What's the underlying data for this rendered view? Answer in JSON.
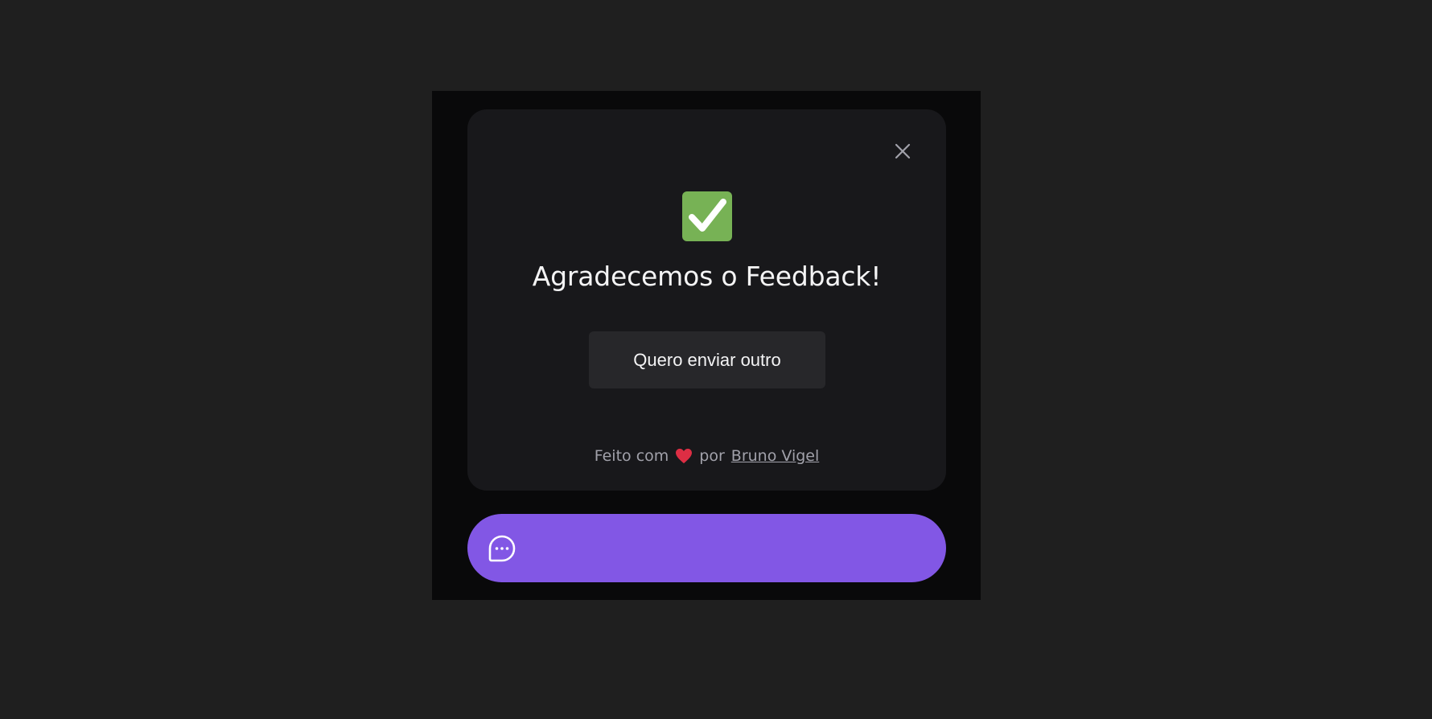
{
  "feedback_widget": {
    "success_icon": "check-mark-icon",
    "title": "Agradecemos o Feedback!",
    "send_another_label": "Quero enviar outro",
    "close_icon": "close-icon",
    "footer": {
      "prefix": "Feito com",
      "heart_icon": "heart-icon",
      "by": "por",
      "author": "Bruno Vigel"
    },
    "launcher_icon": "chat-bubble-icon"
  },
  "colors": {
    "background": "#1f1f1f",
    "stage": "#09090a",
    "card": "#18181b",
    "button": "#27272a",
    "brand": "#8257e5",
    "success": "#77b255",
    "heart": "#dd2e44"
  }
}
